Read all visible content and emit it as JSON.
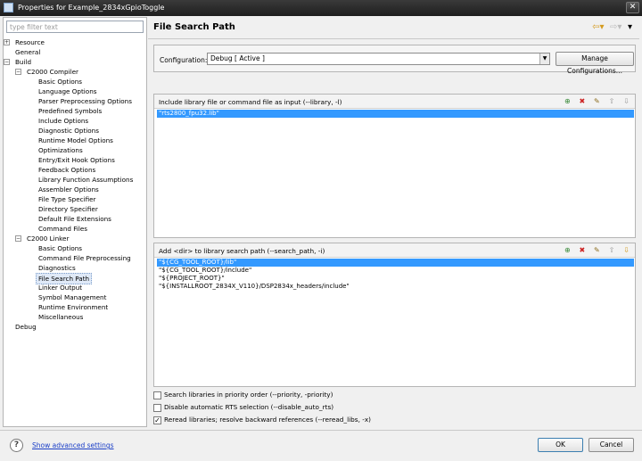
{
  "window": {
    "title": "Properties for Example_2834xGpioToggle",
    "close": "✕"
  },
  "sidebar": {
    "filter_placeholder": "type filter text",
    "tree": [
      {
        "label": "Resource",
        "toggle": "+"
      },
      {
        "label": "General"
      },
      {
        "label": "Build",
        "toggle": "−"
      },
      {
        "label": "C2000 Compiler",
        "toggle": "−"
      },
      {
        "label": "Basic Options"
      },
      {
        "label": "Language Options"
      },
      {
        "label": "Parser Preprocessing Options"
      },
      {
        "label": "Predefined Symbols"
      },
      {
        "label": "Include Options"
      },
      {
        "label": "Diagnostic Options"
      },
      {
        "label": "Runtime Model Options"
      },
      {
        "label": "Optimizations"
      },
      {
        "label": "Entry/Exit Hook Options"
      },
      {
        "label": "Feedback Options"
      },
      {
        "label": "Library Function Assumptions"
      },
      {
        "label": "Assembler Options"
      },
      {
        "label": "File Type Specifier"
      },
      {
        "label": "Directory Specifier"
      },
      {
        "label": "Default File Extensions"
      },
      {
        "label": "Command Files"
      },
      {
        "label": "C2000 Linker",
        "toggle": "−"
      },
      {
        "label": "Basic Options"
      },
      {
        "label": "Command File Preprocessing"
      },
      {
        "label": "Diagnostics"
      },
      {
        "label": "File Search Path"
      },
      {
        "label": "Linker Output"
      },
      {
        "label": "Symbol Management"
      },
      {
        "label": "Runtime Environment"
      },
      {
        "label": "Miscellaneous"
      },
      {
        "label": "Debug"
      }
    ]
  },
  "main": {
    "heading": "File Search Path",
    "nav_icons": [
      "back-icon",
      "forward-icon",
      "menu-icon"
    ],
    "configuration": {
      "label": "Configuration:",
      "value": "Debug  [ Active ]",
      "manage_label": "Manage Configurations..."
    },
    "include_panel": {
      "title": "Include library file or command file as input (--library, -l)",
      "items": [
        "\"rts2800_fpu32.lib\""
      ]
    },
    "search_panel": {
      "title": "Add <dir> to library search path (--search_path, -i)",
      "items": [
        "\"${CG_TOOL_ROOT}/lib\"",
        "\"${CG_TOOL_ROOT}/include\"",
        "\"${PROJECT_ROOT}\"",
        "\"${INSTALLROOT_2834X_V110}/DSP2834x_headers/include\""
      ]
    },
    "options": [
      {
        "label": "Search libraries in priority order (--priority, -priority)",
        "checked": false
      },
      {
        "label": "Disable automatic RTS selection (--disable_auto_rts)",
        "checked": false
      },
      {
        "label": "Reread libraries; resolve backward references (--reread_libs, -x)",
        "checked": true
      }
    ]
  },
  "footer": {
    "advanced_link": "Show advanced settings",
    "ok_label": "OK",
    "cancel_label": "Cancel"
  }
}
